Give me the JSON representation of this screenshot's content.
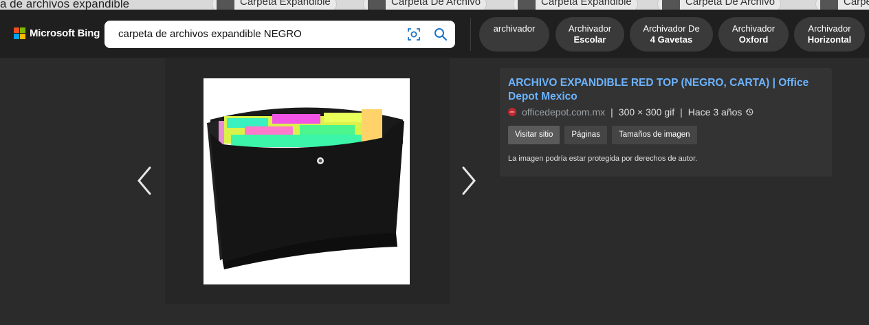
{
  "background_page": {
    "query_fragment": "a de archivos expandible",
    "pills": [
      "Carpeta Expandible",
      "Carpeta De Archivo",
      "Carpeta Expandible",
      "Carpeta De Archivo",
      "Carpe"
    ]
  },
  "header": {
    "brand": "Microsoft Bing",
    "search_value": "carpeta de archivos expandible NEGRO",
    "related_chips": [
      {
        "line1": "archivador",
        "line2": ""
      },
      {
        "line1": "Archivador",
        "line2": "Escolar"
      },
      {
        "line1": "Archivador De",
        "line2": "4 Gavetas"
      },
      {
        "line1": "Archivador",
        "line2": "Oxford"
      },
      {
        "line1": "Archivador",
        "line2": "Horizontal"
      }
    ]
  },
  "detail": {
    "title": "ARCHIVO EXPANDIBLE RED TOP (NEGRO, CARTA) | Office Depot Mexico",
    "source_domain": "officedepot.com.mx",
    "dimensions": "300 × 300 gif",
    "age": "Hace 3 años",
    "separator": "|",
    "buttons": {
      "visit": "Visitar sitio",
      "pages": "Páginas",
      "sizes": "Tamaños de imagen"
    },
    "copyright_notice": "La imagen podría estar protegida por derechos de autor."
  },
  "colors": {
    "accent_link": "#6cb4ff",
    "header_bg": "#1f1f1f",
    "page_bg": "#2b2b2b",
    "logo": [
      "#f25022",
      "#7fba00",
      "#00a4ef",
      "#ffb900"
    ]
  },
  "icons": [
    "visual-search-icon",
    "search-icon",
    "history-icon",
    "chevron-left-icon",
    "chevron-right-icon"
  ]
}
